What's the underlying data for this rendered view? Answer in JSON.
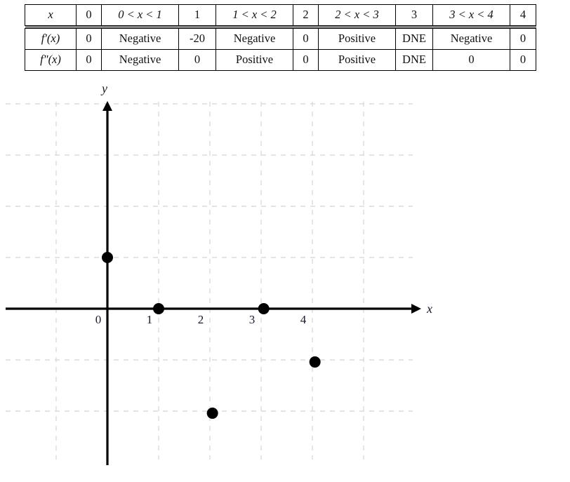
{
  "table": {
    "columns": [
      "row-label",
      "x=0",
      "0<x<1",
      "x=1",
      "1<x<2",
      "x=2",
      "2<x<3",
      "x=3",
      "3<x<4",
      "x=4"
    ],
    "rows": [
      {
        "label": "x",
        "label_kind": "italic",
        "cells": [
          "0",
          "0 < x < 1",
          "1",
          "1 < x < 2",
          "2",
          "2 < x < 3",
          "3",
          "3 < x < 4",
          "4"
        ]
      },
      {
        "label": "f′(x)",
        "label_kind": "italic",
        "cells": [
          "0",
          "Negative",
          "-20",
          "Negative",
          "0",
          "Positive",
          "DNE",
          "Negative",
          "0"
        ]
      },
      {
        "label": "f″(x)",
        "label_kind": "italic",
        "cells": [
          "0",
          "Negative",
          "0",
          "Positive",
          "0",
          "Positive",
          "DNE",
          "0",
          "0"
        ]
      }
    ]
  },
  "graph": {
    "x_axis_label": "x",
    "y_axis_label": "y",
    "x_tick_labels": [
      "0",
      "1",
      "2",
      "3",
      "4"
    ],
    "grid_color": "#dcdcdc",
    "axis_color": "#000000",
    "point_color": "#000000"
  },
  "chart_data": {
    "type": "scatter",
    "title": "",
    "xlabel": "x",
    "ylabel": "y",
    "xlim": [
      -2,
      6.1
    ],
    "ylim": [
      -3.1,
      4.1
    ],
    "grid": true,
    "legend": "none",
    "xticks": [
      0,
      1,
      2,
      3,
      4
    ],
    "yticks": [],
    "points": [
      {
        "x": 0,
        "y": 1
      },
      {
        "x": 1,
        "y": 0
      },
      {
        "x": 2.05,
        "y": -2.04
      },
      {
        "x": 3.05,
        "y": 0
      },
      {
        "x": 4.05,
        "y": -1.04
      }
    ],
    "point_radius": 8
  }
}
